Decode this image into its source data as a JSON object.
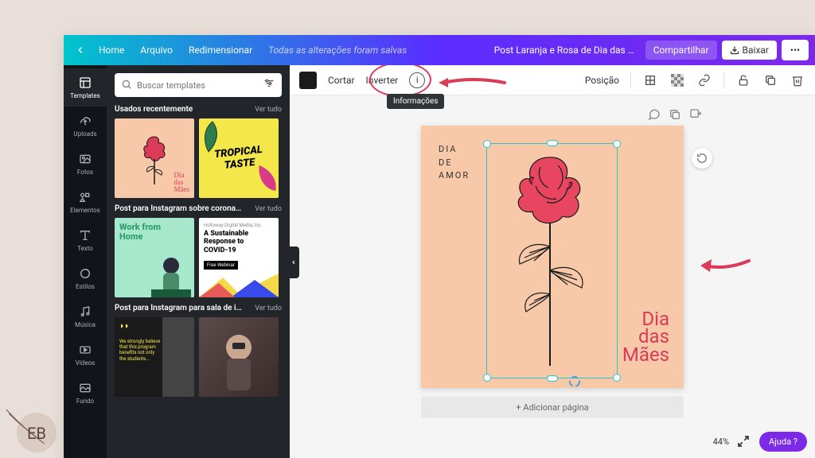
{
  "topbar": {
    "home": "Home",
    "file": "Arquivo",
    "resize": "Redimensionar",
    "status": "Todas as alterações foram salvas",
    "title": "Post Laranja e Rosa de Dia das Mães para In...",
    "share": "Compartilhar",
    "download": "Baixar"
  },
  "rail": [
    {
      "name": "templates",
      "label": "Templates"
    },
    {
      "name": "uploads",
      "label": "Uploads"
    },
    {
      "name": "fotos",
      "label": "Fotos"
    },
    {
      "name": "elementos",
      "label": "Elementos"
    },
    {
      "name": "texto",
      "label": "Texto"
    },
    {
      "name": "estilos",
      "label": "Estilos"
    },
    {
      "name": "musica",
      "label": "Música"
    },
    {
      "name": "videos",
      "label": "Vídeos"
    },
    {
      "name": "fundo",
      "label": "Fundo"
    }
  ],
  "search": {
    "placeholder": "Buscar templates"
  },
  "sections": {
    "s1": {
      "title": "Usados recentemente",
      "seeall": "Ver tudo",
      "t1_script": "Dia\ndas\nMães",
      "t2_text": "TROPICAL\nTASTE"
    },
    "s2": {
      "title": "Post para Instagram sobre corona...",
      "seeall": "Ver tudo",
      "t3_text": "Work from\nHome",
      "t4_head": "A Sustainable\nResponse to\nCOVID-19",
      "t4_btn": "Free Webinar"
    },
    "s3": {
      "title": "Post para Instagram para sala de i...",
      "seeall": "Ver tudo"
    }
  },
  "toolbar": {
    "crop": "Cortar",
    "invert": "Inverter",
    "tooltip": "Informações",
    "position": "Posição"
  },
  "design": {
    "heading_l1": "DIA",
    "heading_l2": "DE",
    "heading_l3": "AMOR",
    "script_l1": "Dia",
    "script_l2": "das",
    "script_l3": "Mães"
  },
  "addpage": "+ Adicionar página",
  "zoom": "44%",
  "help": "Ajuda ?",
  "watermark": "EB"
}
